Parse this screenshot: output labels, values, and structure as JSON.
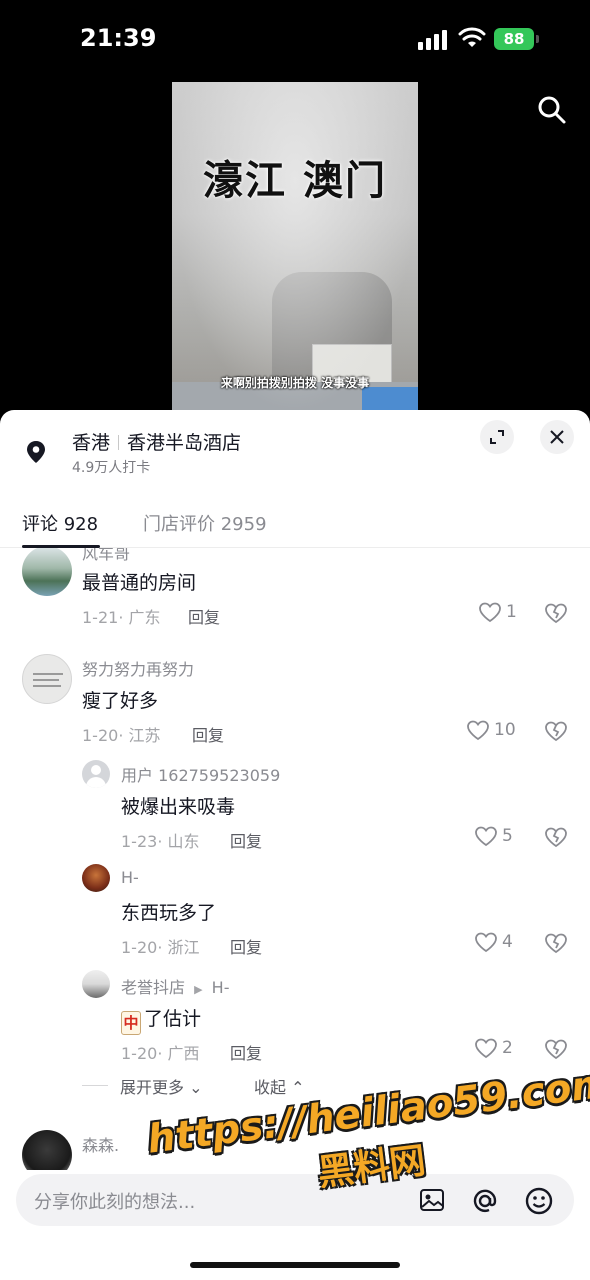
{
  "status_bar": {
    "time": "21:39",
    "battery": "88"
  },
  "video": {
    "title": "濠江 澳门",
    "subtitle": "来啊别拍拨别拍拨 没事没事"
  },
  "location": {
    "city": "香港",
    "place": "香港半岛酒店",
    "checkins": "4.9万人打卡"
  },
  "tabs": [
    {
      "label": "评论 928"
    },
    {
      "label": "门店评价 2959"
    }
  ],
  "comments": [
    {
      "user": "风车哥",
      "text": "最普通的房间",
      "date": "1-21",
      "region": "广东",
      "reply": "回复",
      "likes": "1"
    },
    {
      "user": "努力努力再努力",
      "text": "瘦了好多",
      "date": "1-20",
      "region": "江苏",
      "reply": "回复",
      "likes": "10",
      "replies": [
        {
          "user": "用户 162759523059",
          "text": "被爆出来吸毒",
          "date": "1-23",
          "region": "山东",
          "reply": "回复",
          "likes": "5"
        },
        {
          "user": "H-",
          "text": "东西玩多了",
          "date": "1-20",
          "region": "浙江",
          "reply": "回复",
          "likes": "4"
        },
        {
          "user": "老誉抖店",
          "reply_to": "H-",
          "emoji": "中",
          "text": "了估计",
          "date": "1-20",
          "region": "广西",
          "reply": "回复",
          "likes": "2"
        }
      ]
    },
    {
      "user": "森森.",
      "text": ""
    }
  ],
  "expand": {
    "more": "展开更多",
    "collapse": "收起"
  },
  "input": {
    "placeholder": "分享你此刻的想法..."
  },
  "watermark": {
    "url": "https://heiliao59.com",
    "name": "黑料网"
  },
  "colors": {
    "battery": "#34c759",
    "watermark": "#f4a825"
  }
}
